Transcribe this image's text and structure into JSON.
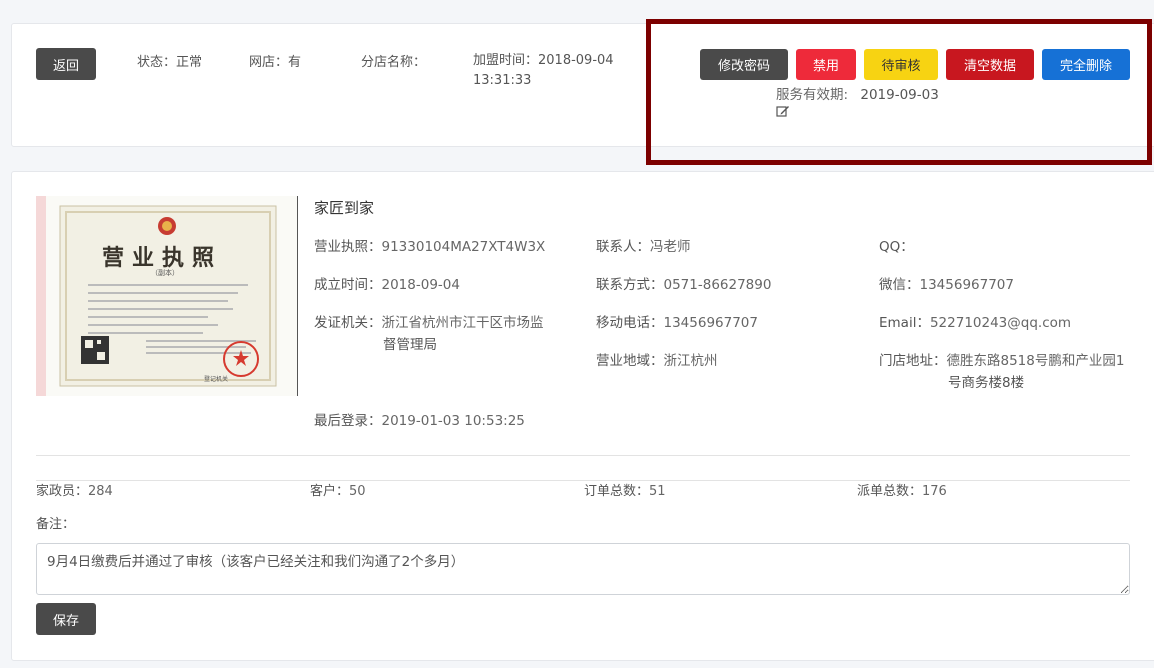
{
  "header": {
    "back_label": "返回",
    "status_label": "状态：",
    "status_value": "正常",
    "shop_label": "网店：",
    "shop_value": "有",
    "branch_label": "分店名称：",
    "branch_value": "",
    "join_label": "加盟时间：",
    "join_date": "2018-09-04",
    "join_time": "13:31:33"
  },
  "actions": {
    "change_password": "修改密码",
    "disable": "禁用",
    "pending_review": "待审核",
    "clear_data": "清空数据",
    "delete_all": "完全删除",
    "service_valid_label": "服务有效期:",
    "service_valid_value": "2019-09-03"
  },
  "license": {
    "title": "营业执照",
    "subtitle": "（副本）",
    "seal_text": "登记机关"
  },
  "company": {
    "name": "家匠到家",
    "license_label": "营业执照：",
    "license_value": "91330104MA27XT4W3X",
    "founded_label": "成立时间：",
    "founded_value": "2018-09-04",
    "issuer_label": "发证机关：",
    "issuer_line1": "浙江省杭州市江干区市场监",
    "issuer_line2": "督管理局",
    "last_login_label": "最后登录：",
    "last_login_value": "2019-01-03 10:53:25",
    "contact_label": "联系人：",
    "contact_value": "冯老师",
    "phone_label": "联系方式：",
    "phone_value": "0571-86627890",
    "mobile_label": "移动电话：",
    "mobile_value": "13456967707",
    "region_label": "营业地域：",
    "region_value": "浙江杭州",
    "qq_label": "QQ：",
    "qq_value": "",
    "wechat_label": "微信：",
    "wechat_value": "13456967707",
    "email_label": "Email：",
    "email_value": "522710243@qq.com",
    "address_label": "门店地址：",
    "address_line1": "德胜东路8518号鹏和产业园1",
    "address_line2": "号商务楼8楼"
  },
  "stats": {
    "staff_label": "家政员：",
    "staff_value": "284",
    "customers_label": "客户：",
    "customers_value": "50",
    "orders_label": "订单总数：",
    "orders_value": "51",
    "dispatch_label": "派单总数：",
    "dispatch_value": "176"
  },
  "notes": {
    "label": "备注：",
    "value": "9月4日缴费后并通过了审核（该客户已经关注和我们沟通了2个多月）",
    "save_label": "保存"
  },
  "colors": {
    "highlight_border": "#7c0000",
    "btn_dark": "#4a4a4a",
    "btn_red": "#ee2a3a",
    "btn_yellow": "#f7d312",
    "btn_crimson": "#c8171f",
    "btn_blue": "#1671d6"
  }
}
